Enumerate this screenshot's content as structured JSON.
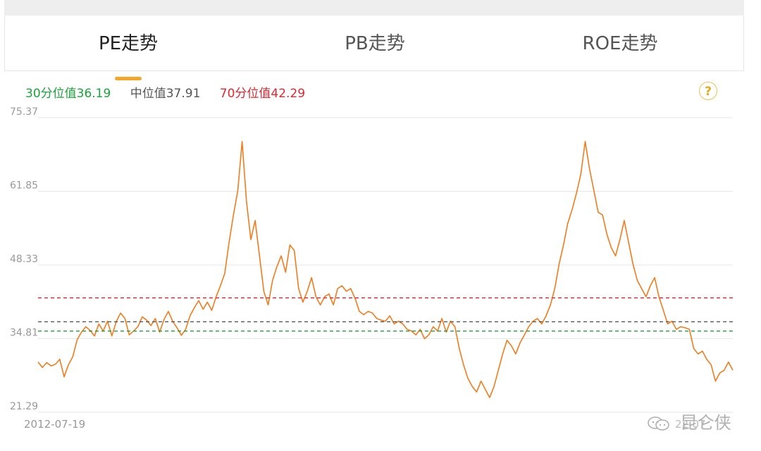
{
  "tabs": [
    {
      "label": "PE走势",
      "active": true
    },
    {
      "label": "PB走势",
      "active": false
    },
    {
      "label": "ROE走势",
      "active": false
    }
  ],
  "legend": {
    "p30": {
      "label": "30分位值36.19",
      "color": "#1aa33a"
    },
    "median": {
      "label": "中位值37.91",
      "color": "#555555"
    },
    "p70": {
      "label": "70分位值42.29",
      "color": "#e0262f"
    }
  },
  "help_icon": {
    "label": "?",
    "icon": "question-circle-icon"
  },
  "watermark": {
    "text": "昆仑侠",
    "icon": "wechat-icon"
  },
  "chart_data": {
    "type": "line",
    "ylim": [
      21.29,
      75.37
    ],
    "yticks": [
      "75.37",
      "61.85",
      "48.33",
      "34.81",
      "21.29"
    ],
    "xticks": [
      "2012-07-19",
      "22-07"
    ],
    "grid": true,
    "reference_lines": [
      {
        "name": "30分位值",
        "value": 36.19,
        "color": "#1aa33a",
        "style": "dashed"
      },
      {
        "name": "中位值",
        "value": 37.91,
        "color": "#555555",
        "style": "dashed"
      },
      {
        "name": "70分位值",
        "value": 42.29,
        "color": "#e0262f",
        "style": "dashed"
      }
    ],
    "series": [
      {
        "color": "#f07c1e",
        "values": [
          30.5,
          29.5,
          30.4,
          29.8,
          30.1,
          31.0,
          27.8,
          30.0,
          31.5,
          34.6,
          36.0,
          37.0,
          36.3,
          35.3,
          37.5,
          36.2,
          38.0,
          35.3,
          37.9,
          39.5,
          38.5,
          35.5,
          36.2,
          37.0,
          38.8,
          38.2,
          37.2,
          38.5,
          36.0,
          38.3,
          39.8,
          38.0,
          36.8,
          35.4,
          36.5,
          39.0,
          40.5,
          41.8,
          40.2,
          41.5,
          40.0,
          42.5,
          44.5,
          46.8,
          52.5,
          57.5,
          62.0,
          71.0,
          60.0,
          53.0,
          56.5,
          50.0,
          43.5,
          41.0,
          45.5,
          48.0,
          50.0,
          47.0,
          52.0,
          51.0,
          44.0,
          41.5,
          43.5,
          46.0,
          42.5,
          41.0,
          42.5,
          43.0,
          41.0,
          44.0,
          44.5,
          43.5,
          44.0,
          42.2,
          39.8,
          39.2,
          39.8,
          39.5,
          38.5,
          38.2,
          38.0,
          39.0,
          37.5,
          38.0,
          37.5,
          36.5,
          36.2,
          35.5,
          36.5,
          34.8,
          35.5,
          37.0,
          36.2,
          38.5,
          36.0,
          38.0,
          37.0,
          33.0,
          30.0,
          27.5,
          26.0,
          25.0,
          27.0,
          25.5,
          24.0,
          26.0,
          29.0,
          32.0,
          34.5,
          33.5,
          32.0,
          34.0,
          35.5,
          37.0,
          38.0,
          38.5,
          37.5,
          39.0,
          41.0,
          44.0,
          48.5,
          52.0,
          56.0,
          58.5,
          61.5,
          65.0,
          71.0,
          66.0,
          62.0,
          58.0,
          57.5,
          54.0,
          51.5,
          50.0,
          53.0,
          56.5,
          52.5,
          48.5,
          45.5,
          44.0,
          42.5,
          44.5,
          46.0,
          42.5,
          40.0,
          37.5,
          38.0,
          36.5,
          37.0,
          36.8,
          36.5,
          33.0,
          32.0,
          32.5,
          31.0,
          30.0,
          27.0,
          28.5,
          29.0,
          30.5,
          29.0
        ]
      }
    ]
  }
}
